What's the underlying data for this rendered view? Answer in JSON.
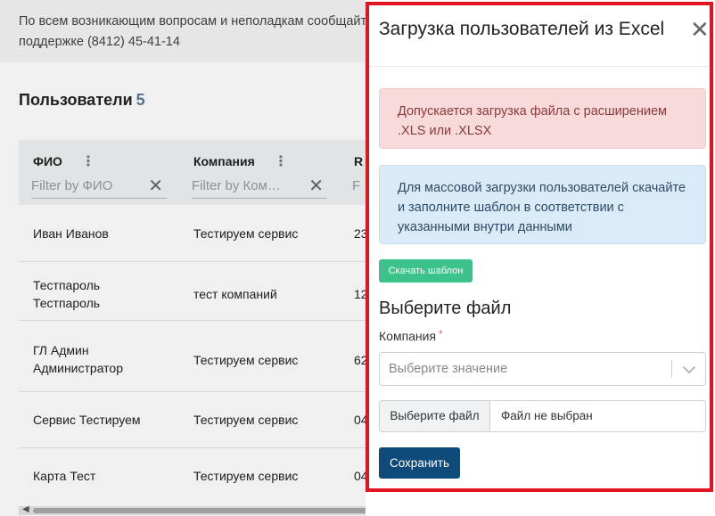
{
  "background": {
    "notice": "По всем возникающим вопросам и неполадкам сообщайте\nподдержке (8412) 45-41-14",
    "users_title": "Пользователи",
    "users_count": "5",
    "columns": [
      {
        "label": "ФИО",
        "filter_placeholder": "Filter by ФИО"
      },
      {
        "label": "Компания",
        "filter_placeholder": "Filter by Ком…"
      },
      {
        "label": "R",
        "filter_placeholder": "F"
      }
    ],
    "rows": [
      {
        "name": "Иван Иванов",
        "company": "Тестируем сервис",
        "third": "23"
      },
      {
        "name": "Тестпароль Тестпароль",
        "company": "тест компаний",
        "third": "12"
      },
      {
        "name": "ГЛ Админ Администратор",
        "company": "Тестируем сервис",
        "third": "62"
      },
      {
        "name": "Сервис Тестируем",
        "company": "Тестируем сервис",
        "third": "04"
      },
      {
        "name": "Карта Тест",
        "company": "Тестируем сервис",
        "third": "04"
      }
    ]
  },
  "modal": {
    "title": "Загрузка пользователей из Excel",
    "close_icon": "close-icon",
    "alert_danger": "Допускается загрузка файла с расширением .XLS или .XLSX",
    "alert_info": "Для массовой загрузки пользователей скачайте и заполните шаблон в соответствии с указанными внутри данными",
    "download_template": "Скачать шаблон",
    "section_title": "Выберите файл",
    "company_label": "Компания",
    "required_mark": "*",
    "select_placeholder": "Выберите значение",
    "file_button": "Выберите файл",
    "file_name": "Файл не выбран",
    "save_button": "Сохранить"
  },
  "colors": {
    "highlight": "#e3141f",
    "primary": "#0e4a7a",
    "success": "#3cc38c",
    "danger_bg": "#f9dada",
    "info_bg": "#d9ebf8"
  }
}
